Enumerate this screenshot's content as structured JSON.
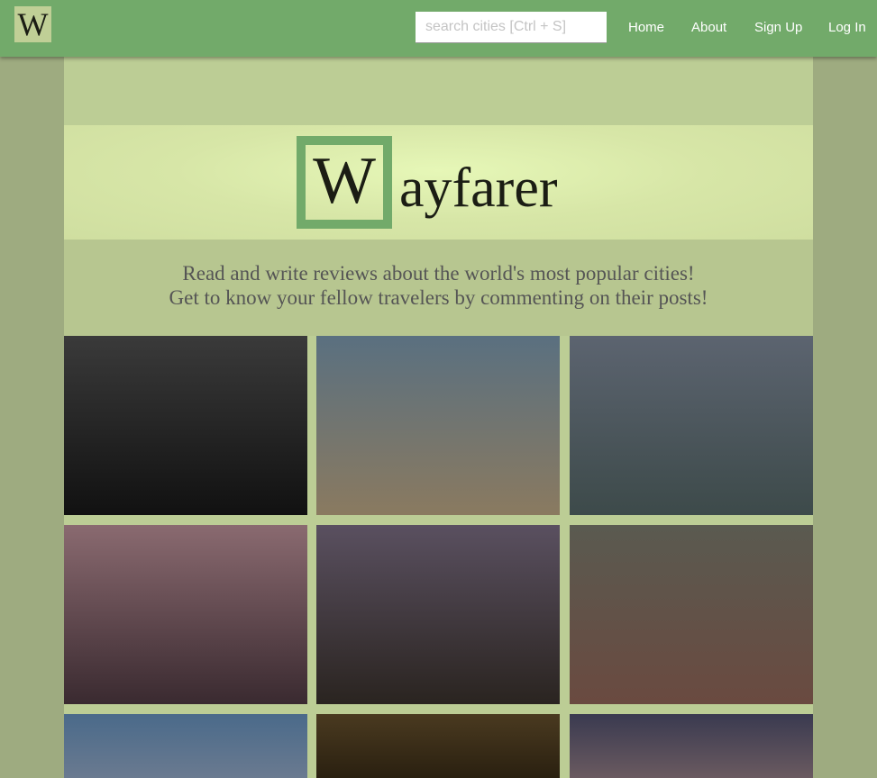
{
  "nav": {
    "logo": "W",
    "search_placeholder": "search cities [Ctrl + S]",
    "links": [
      "Home",
      "About",
      "Sign Up",
      "Log In"
    ]
  },
  "hero": {
    "brand_initial": "W",
    "brand_rest": "ayfarer"
  },
  "tagline": {
    "line1": "Read and write reviews about the world's most popular cities!",
    "line2": "Get to know your fellow travelers by commenting on their posts!"
  },
  "cities": [
    {
      "colors": [
        "#3a3a3a",
        "#111"
      ]
    },
    {
      "colors": [
        "#5a7080",
        "#8a7a60"
      ]
    },
    {
      "colors": [
        "#5c6470",
        "#3d4a4a"
      ]
    },
    {
      "colors": [
        "#8a6a70",
        "#3a2a30"
      ]
    },
    {
      "colors": [
        "#5a5060",
        "#2a2420"
      ]
    },
    {
      "colors": [
        "#5a5a50",
        "#6a4a40"
      ]
    },
    {
      "colors": [
        "#4a6a8a",
        "#6a7a90"
      ]
    },
    {
      "colors": [
        "#4a3a20",
        "#2a2010"
      ]
    },
    {
      "colors": [
        "#3a3a50",
        "#6a5a60"
      ]
    }
  ]
}
